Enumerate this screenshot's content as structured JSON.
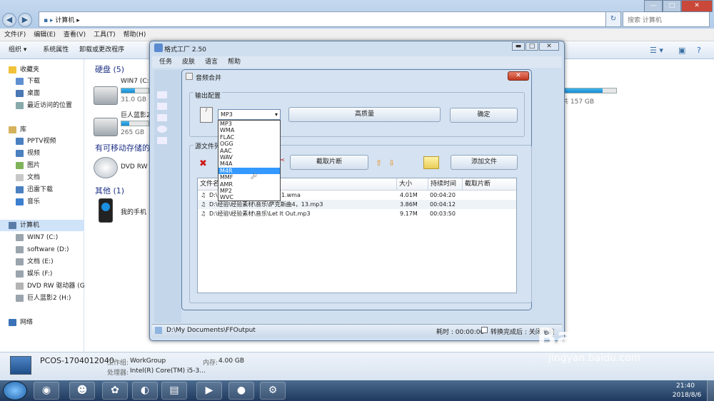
{
  "explorer": {
    "address": "计算机",
    "search_placeholder": "搜索 计算机",
    "menu": [
      "文件(F)",
      "编辑(E)",
      "查看(V)",
      "工具(T)",
      "帮助(H)"
    ],
    "commands": [
      "组织 ▾",
      "系统属性",
      "卸载或更改程序"
    ],
    "nav": {
      "favorites": "收藏夹",
      "fav_items": [
        "下载",
        "桌面",
        "最近访问的位置"
      ],
      "library": "库",
      "lib_items": [
        "PPTV视频",
        "视频",
        "图片",
        "文档",
        "迅雷下载",
        "音乐"
      ],
      "computer": "计算机",
      "comp_items": [
        "WIN7 (C:)",
        "software (D:)",
        "文档 (E:)",
        "娱乐 (F:)",
        "DVD RW 驱动器 (G",
        "巨人蓝影2 (H:)"
      ],
      "network": "网络"
    },
    "groups": {
      "disks": "硬盘 (5)",
      "removable": "有可移动存储的",
      "other": "其他 (1)"
    },
    "drives": [
      {
        "name": "WIN7 (C:",
        "size": "31.0 GB",
        "fill": 0.5
      },
      {
        "name": "巨人蓝影2",
        "size": "265 GB",
        "fill": 0.3
      }
    ],
    "right_drive": {
      "size": "共 157 GB",
      "fill": 0.75
    },
    "dvd": "DVD RW",
    "phone": "我的手机",
    "details": {
      "pc": "PCOS-1704012040",
      "workgroup_label": "工作组:",
      "workgroup": "WorkGroup",
      "memory_label": "内存:",
      "memory": "4.00 GB",
      "cpu_label": "处理器:",
      "cpu": "Intel(R) Core(TM) i5-3..."
    }
  },
  "taskbar": {
    "time": "21:40",
    "date": "2018/8/6"
  },
  "ff": {
    "title": "格式工厂 2.50",
    "menu": [
      "任务",
      "皮肤",
      "语言",
      "帮助"
    ],
    "status_path": "D:\\My Documents\\FFOutput",
    "status_elapsed": "耗时 : 00:00:00",
    "status_after": "转换完成后 : 关闭电脑"
  },
  "dialog": {
    "title": "音频合并",
    "output_label": "输出配置",
    "format": "MP3",
    "quality_btn": "高质量",
    "ok_btn": "确定",
    "source_label": "源文件列",
    "clip_btn": "截取片断",
    "add_btn": "添加文件",
    "formats": [
      "MP3",
      "WMA",
      "FLAC",
      "OGG",
      "AAC",
      "WAV",
      "M4A",
      "M4R",
      "MMF",
      "AMR",
      "MP2",
      "WVC"
    ],
    "selected_format": "M4R",
    "columns": [
      "文件名",
      "大小",
      "持续时间",
      "截取片断"
    ],
    "rows": [
      {
        "name": "D:\\",
        "name2": "1.wma",
        "size": "4.01M",
        "duration": "00:04:20"
      },
      {
        "name": "D:\\经验\\经验素材\\音乐\\萨克斯曲4，13.mp3",
        "name2": "",
        "size": "3.86M",
        "duration": "00:04:12"
      },
      {
        "name": "D:\\经验\\经验素材\\音乐\\Let It Out.mp3",
        "name2": "",
        "size": "9.17M",
        "duration": "00:03:50"
      }
    ]
  },
  "watermark": {
    "brand": "Bai",
    "brand2": "du",
    "cn": "经验",
    "url": "jingyan.baidu.com"
  }
}
